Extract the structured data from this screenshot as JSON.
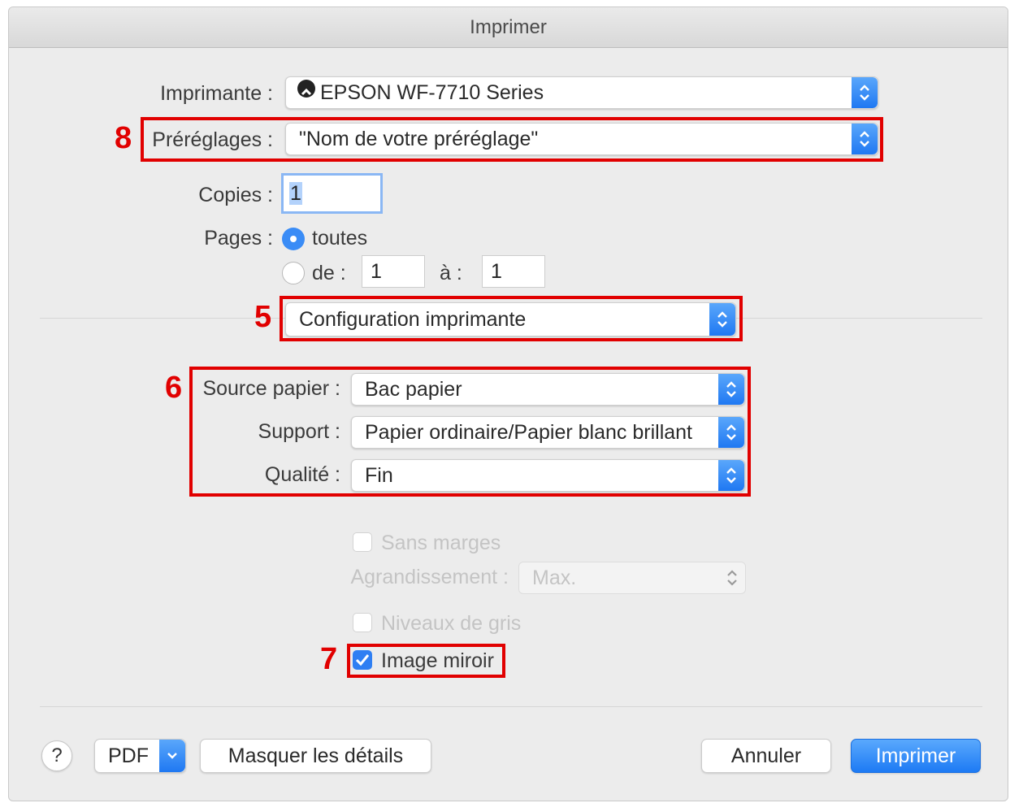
{
  "window": {
    "title": "Imprimer"
  },
  "printer": {
    "label": "Imprimante :",
    "value": "EPSON WF-7710 Series"
  },
  "presets": {
    "label": "Préréglages :",
    "value": "\"Nom de votre préréglage\""
  },
  "copies": {
    "label": "Copies :",
    "value": "1"
  },
  "pages": {
    "label": "Pages :",
    "all_label": "toutes",
    "all_selected": true,
    "range_from_label": "de :",
    "range_to_label": "à :",
    "from_value": "1",
    "to_value": "1"
  },
  "section_menu": {
    "value": "Configuration imprimante"
  },
  "paper_source": {
    "label": "Source papier :",
    "value": "Bac papier"
  },
  "media": {
    "label": "Support :",
    "value": "Papier ordinaire/Papier blanc brillant"
  },
  "quality": {
    "label": "Qualité :",
    "value": "Fin"
  },
  "borderless": {
    "label": "Sans marges",
    "checked": false,
    "enabled": false
  },
  "expansion": {
    "label": "Agrandissement :",
    "value": "Max.",
    "enabled": false
  },
  "grayscale": {
    "label": "Niveaux de gris",
    "checked": false,
    "enabled": false
  },
  "mirror": {
    "label": "Image miroir",
    "checked": true
  },
  "annotations": {
    "n5": "5",
    "n6": "6",
    "n7": "7",
    "n8": "8"
  },
  "footer": {
    "help": "?",
    "pdf": "PDF",
    "hide_details": "Masquer les détails",
    "cancel": "Annuler",
    "print": "Imprimer"
  },
  "colors": {
    "accent": "#1f78f2",
    "annotation": "#e10000"
  }
}
